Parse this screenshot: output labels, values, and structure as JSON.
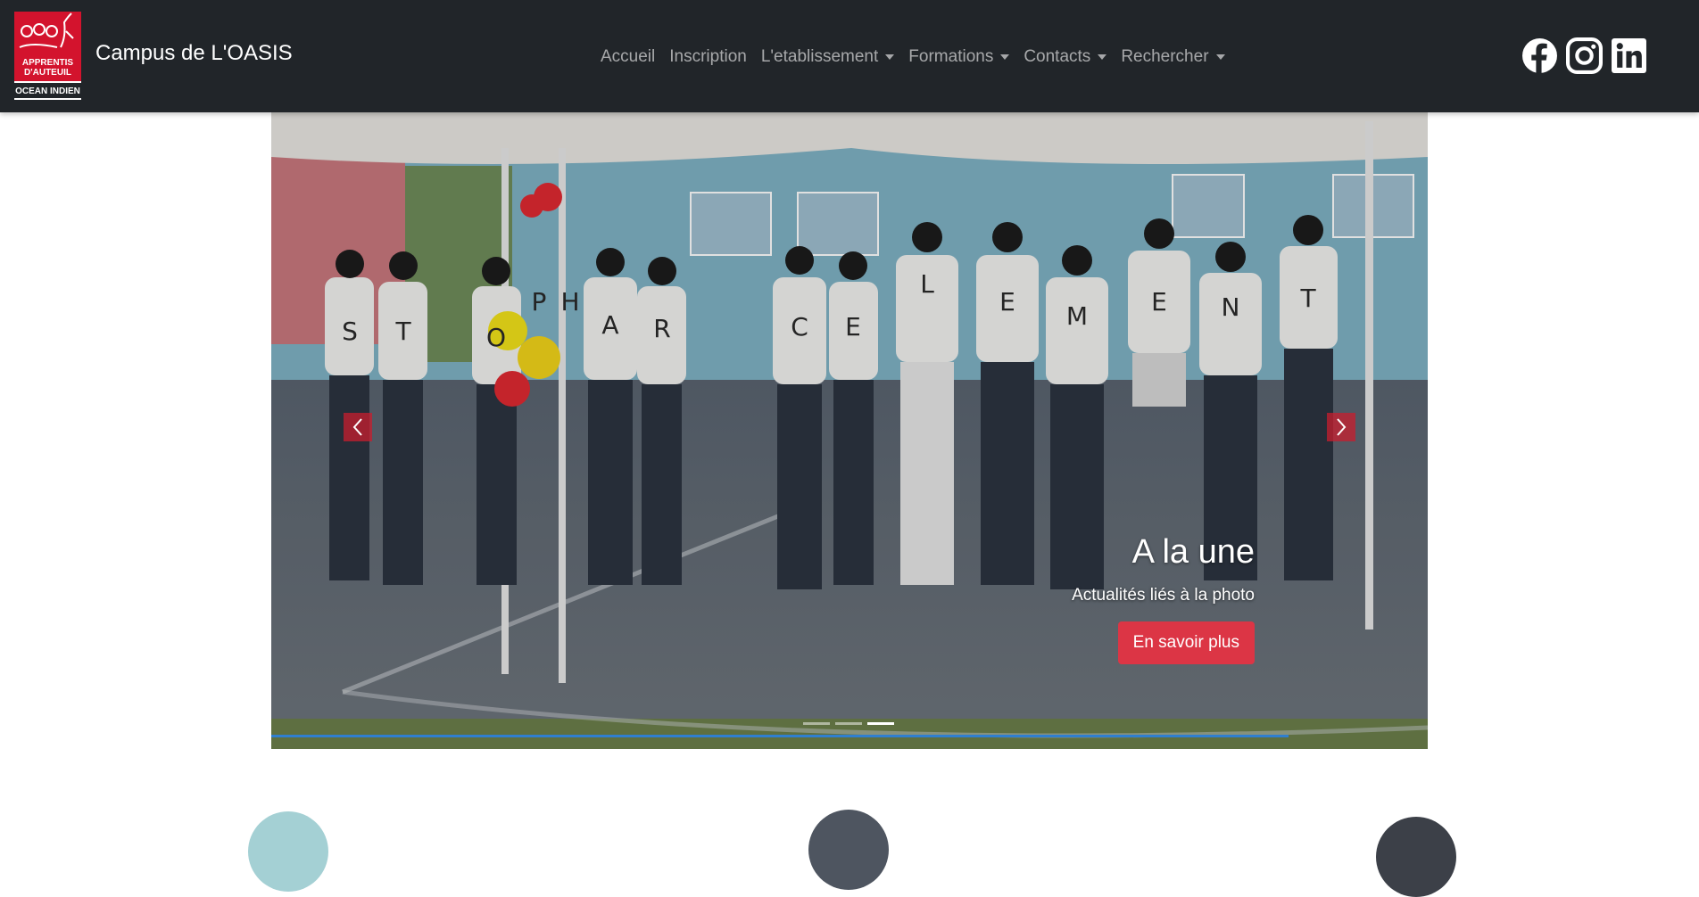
{
  "logo": {
    "line1": "APPRENTIS",
    "line2": "D'AUTEUIL",
    "bottom": "OCEAN INDIEN",
    "brand_color": "#d3132d"
  },
  "brand": {
    "title": "Campus de L'OASIS"
  },
  "nav": {
    "items": [
      {
        "label": "Accueil",
        "dropdown": false
      },
      {
        "label": "Inscription",
        "dropdown": false
      },
      {
        "label": "L'etablissement",
        "dropdown": true
      },
      {
        "label": "Formations",
        "dropdown": true
      },
      {
        "label": "Contacts",
        "dropdown": true
      },
      {
        "label": "Rechercher",
        "dropdown": true
      }
    ]
  },
  "socials": [
    "facebook-icon",
    "instagram-icon",
    "linkedin-icon"
  ],
  "carousel": {
    "slide_letters": [
      "S",
      "T",
      "O",
      "P",
      "H",
      "A",
      "R",
      "C",
      "E",
      "L",
      "E",
      "M",
      "E",
      "N",
      "T"
    ],
    "caption_title": "A la une",
    "caption_text": "Actualités liés à la photo",
    "button_label": "En savoir plus",
    "button_color": "#dc3545",
    "indicator_count": 3,
    "active_indicator": 3,
    "progress": 0.88
  },
  "colors": {
    "navbar": "#212529",
    "progress": "#2f7fd0"
  }
}
